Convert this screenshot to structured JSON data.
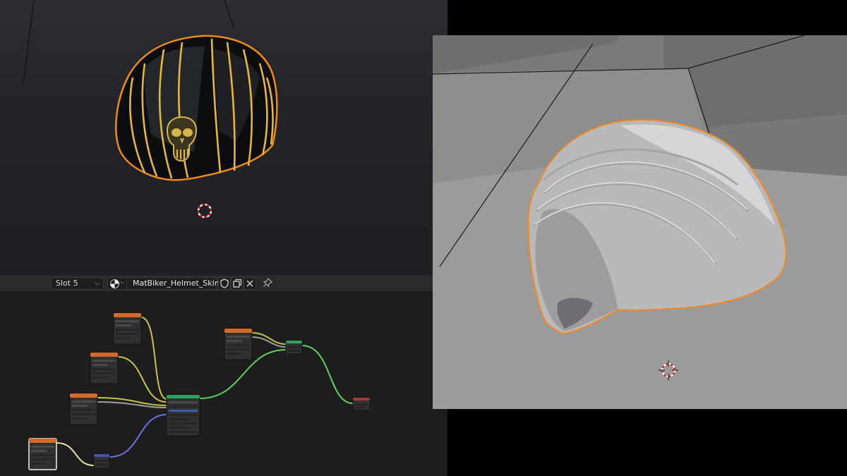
{
  "node_editor": {
    "slot": {
      "value": "Slot 5"
    },
    "material": {
      "name": "MatBiker_Helmet_Skin5"
    }
  },
  "icons": {
    "slot_dropdown": "chevron-down-icon",
    "material_browse": "material-sphere-icon",
    "fake_user": "shield-icon",
    "duplicate": "duplicate-icon",
    "unlink": "close-icon",
    "pin": "pin-icon",
    "cursor": "3d-cursor-icon"
  },
  "colors": {
    "selection_outline": "#f28a1a",
    "helmet_stripe": "#e7b63a",
    "node_header_texture": "#d46a2a",
    "node_header_shader": "#2fa35a",
    "node_header_vector": "#4a52b8",
    "link_yellow": "#c8c44a",
    "link_green": "#5fd05a",
    "link_blue": "#6c6fe0",
    "link_grey": "#a0a0a0"
  }
}
